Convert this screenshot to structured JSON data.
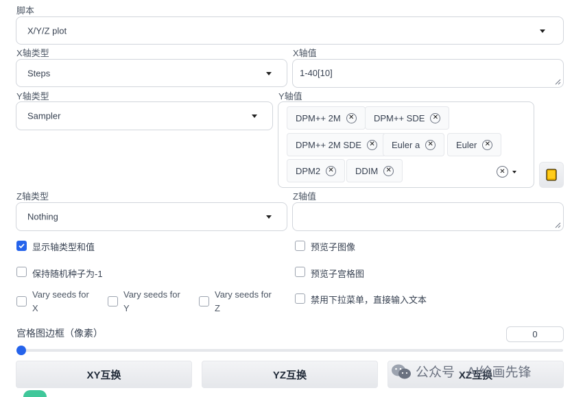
{
  "script": {
    "label": "脚本",
    "value": "X/Y/Z plot"
  },
  "x_type": {
    "label": "X轴类型",
    "value": "Steps"
  },
  "x_values": {
    "label": "X轴值",
    "value": "1-40[10]"
  },
  "y_type": {
    "label": "Y轴类型",
    "value": "Sampler"
  },
  "y_values": {
    "label": "Y轴值",
    "chips": [
      "DPM++ 2M",
      "DPM++ SDE",
      "DPM++ 2M SDE",
      "Euler a",
      "Euler",
      "DPM2",
      "DDIM"
    ]
  },
  "z_type": {
    "label": "Z轴类型",
    "value": "Nothing"
  },
  "z_values": {
    "label": "Z轴值",
    "value": ""
  },
  "checkboxes": {
    "show_axis": {
      "label": "显示轴类型和值",
      "checked": true
    },
    "preview_sub": {
      "label": "预览子图像",
      "checked": false
    },
    "keep_seed": {
      "label": "保持随机种子为-1",
      "checked": false
    },
    "preview_grid": {
      "label": "预览子宫格图",
      "checked": false
    },
    "vary_x_1": "Vary seeds for",
    "vary_x_2": "X",
    "vary_y_1": "Vary seeds for",
    "vary_y_2": "Y",
    "vary_z_1": "Vary seeds for",
    "vary_z_2": "Z",
    "disable_dropdown": {
      "label": "禁用下拉菜单，直接输入文本",
      "checked": false
    }
  },
  "margin": {
    "label": "宫格图边框（像素）",
    "value": "0",
    "slider_fraction": 0.0
  },
  "buttons": {
    "xy": "XY互换",
    "yz": "YZ互换",
    "xz": "XZ互换"
  },
  "watermark": {
    "prefix": "公众号 ·",
    "name": "AI绘画先锋"
  },
  "colors": {
    "accent": "#2563eb",
    "folder_icon": "#f5b800"
  },
  "icons": [
    "close-icon",
    "chevron-down-icon",
    "folder-icon",
    "checkbox-check-icon",
    "wechat-icon"
  ]
}
